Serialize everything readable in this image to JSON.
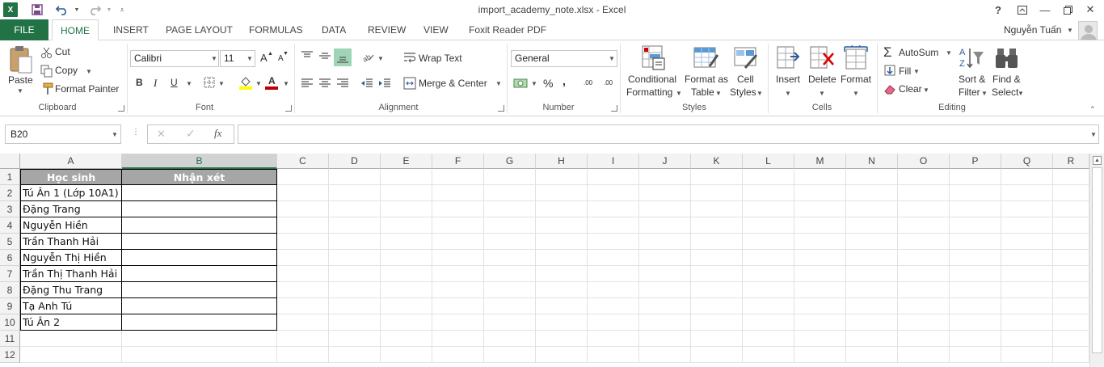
{
  "window": {
    "title": "import_academy_note.xlsx - Excel",
    "user": "Nguyễn Tuấn"
  },
  "tabs": [
    "FILE",
    "HOME",
    "INSERT",
    "PAGE LAYOUT",
    "FORMULAS",
    "DATA",
    "REVIEW",
    "VIEW",
    "Foxit Reader PDF"
  ],
  "clipboard": {
    "paste": "Paste",
    "cut": "Cut",
    "copy": "Copy",
    "format_painter": "Format Painter",
    "label": "Clipboard"
  },
  "font": {
    "name": "Calibri",
    "size": "11",
    "bold": "B",
    "italic": "I",
    "underline": "U",
    "label": "Font",
    "grow": "A",
    "shrink": "A",
    "color_letter": "A"
  },
  "alignment": {
    "wrap_text": "Wrap Text",
    "merge_center": "Merge & Center",
    "label": "Alignment"
  },
  "number": {
    "format": "General",
    "percent": "%",
    "comma": ",",
    "label": "Number",
    "inc_decimal": ".00",
    "dec_decimal": ".00"
  },
  "styles": {
    "conditional_1": "Conditional",
    "conditional_2": "Formatting",
    "format_table_1": "Format as",
    "format_table_2": "Table",
    "cell_styles_1": "Cell",
    "cell_styles_2": "Styles",
    "label": "Styles"
  },
  "cells": {
    "insert": "Insert",
    "delete": "Delete",
    "format": "Format",
    "label": "Cells"
  },
  "editing": {
    "autosum": "AutoSum",
    "fill": "Fill",
    "clear": "Clear",
    "sort_1": "Sort &",
    "sort_2": "Filter",
    "find_1": "Find &",
    "find_2": "Select",
    "label": "Editing"
  },
  "formula_bar": {
    "name_box": "B20",
    "formula": "",
    "fx": "fx",
    "cancel": "✕",
    "enter": "✓"
  },
  "columns": [
    "A",
    "B",
    "C",
    "D",
    "E",
    "F",
    "G",
    "H",
    "I",
    "J",
    "K",
    "L",
    "M",
    "N",
    "O",
    "P",
    "Q",
    "R"
  ],
  "rows": [
    "1",
    "2",
    "3",
    "4",
    "5",
    "6",
    "7",
    "8",
    "9",
    "10",
    "11",
    "12"
  ],
  "sheet": {
    "headers": [
      "Học sinh",
      "Nhận xét"
    ],
    "students": [
      "Tú Ân 1 (Lớp 10A1)",
      "Đặng Trang",
      "Nguyễn Hiền",
      "Trần Thanh Hải",
      "Nguyễn Thị Hiền",
      "Trần Thị Thanh Hải",
      "Đặng Thu Trang",
      "Tạ Anh Tú",
      "Tú Ân 2"
    ]
  },
  "colors": {
    "accent": "#217346",
    "header_fill": "#a6a6a6"
  }
}
